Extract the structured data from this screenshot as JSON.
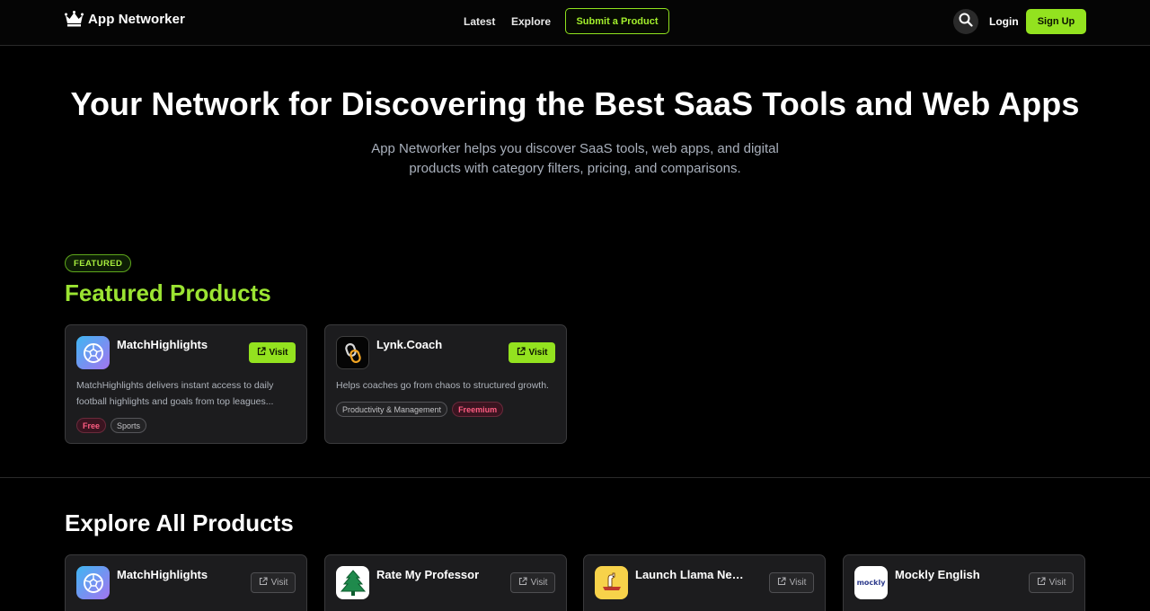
{
  "brand": {
    "name": "App Networker",
    "logo_icon": "crown-icon"
  },
  "nav": {
    "latest": "Latest",
    "explore": "Explore",
    "submit": "Submit a Product",
    "login": "Login",
    "signup": "Sign Up",
    "search_icon": "search-icon"
  },
  "hero": {
    "title": "Your Network for Discovering the Best SaaS Tools and Web Apps",
    "subtitle": "App Networker helps you discover SaaS tools, web apps, and digital products with category filters, pricing, and comparisons."
  },
  "featured": {
    "badge": "FEATURED",
    "title": "Featured Products",
    "cards": [
      {
        "name": "MatchHighlights",
        "visit": "Visit",
        "description": "MatchHighlights delivers instant access to daily football highlights and goals from top leagues...",
        "tags": [
          "Free",
          "Sports"
        ]
      },
      {
        "name": "Lynk.Coach",
        "visit": "Visit",
        "description": "Helps coaches go from chaos to structured growth.",
        "tags": [
          "Productivity & Management",
          "Freemium"
        ]
      }
    ]
  },
  "explore": {
    "title": "Explore All Products",
    "cards": [
      {
        "name": "MatchHighlights",
        "visit": "Visit"
      },
      {
        "name": "Rate My Professor",
        "visit": "Visit"
      },
      {
        "name": "Launch Llama Newsle...",
        "visit": "Visit"
      },
      {
        "name": "Mockly English",
        "visit": "Visit",
        "logo_text": "mockly"
      }
    ]
  },
  "colors": {
    "accent": "#93e21f",
    "background": "#000000",
    "card": "#1c1c1e",
    "pricing_pink": "#ff5d82"
  }
}
